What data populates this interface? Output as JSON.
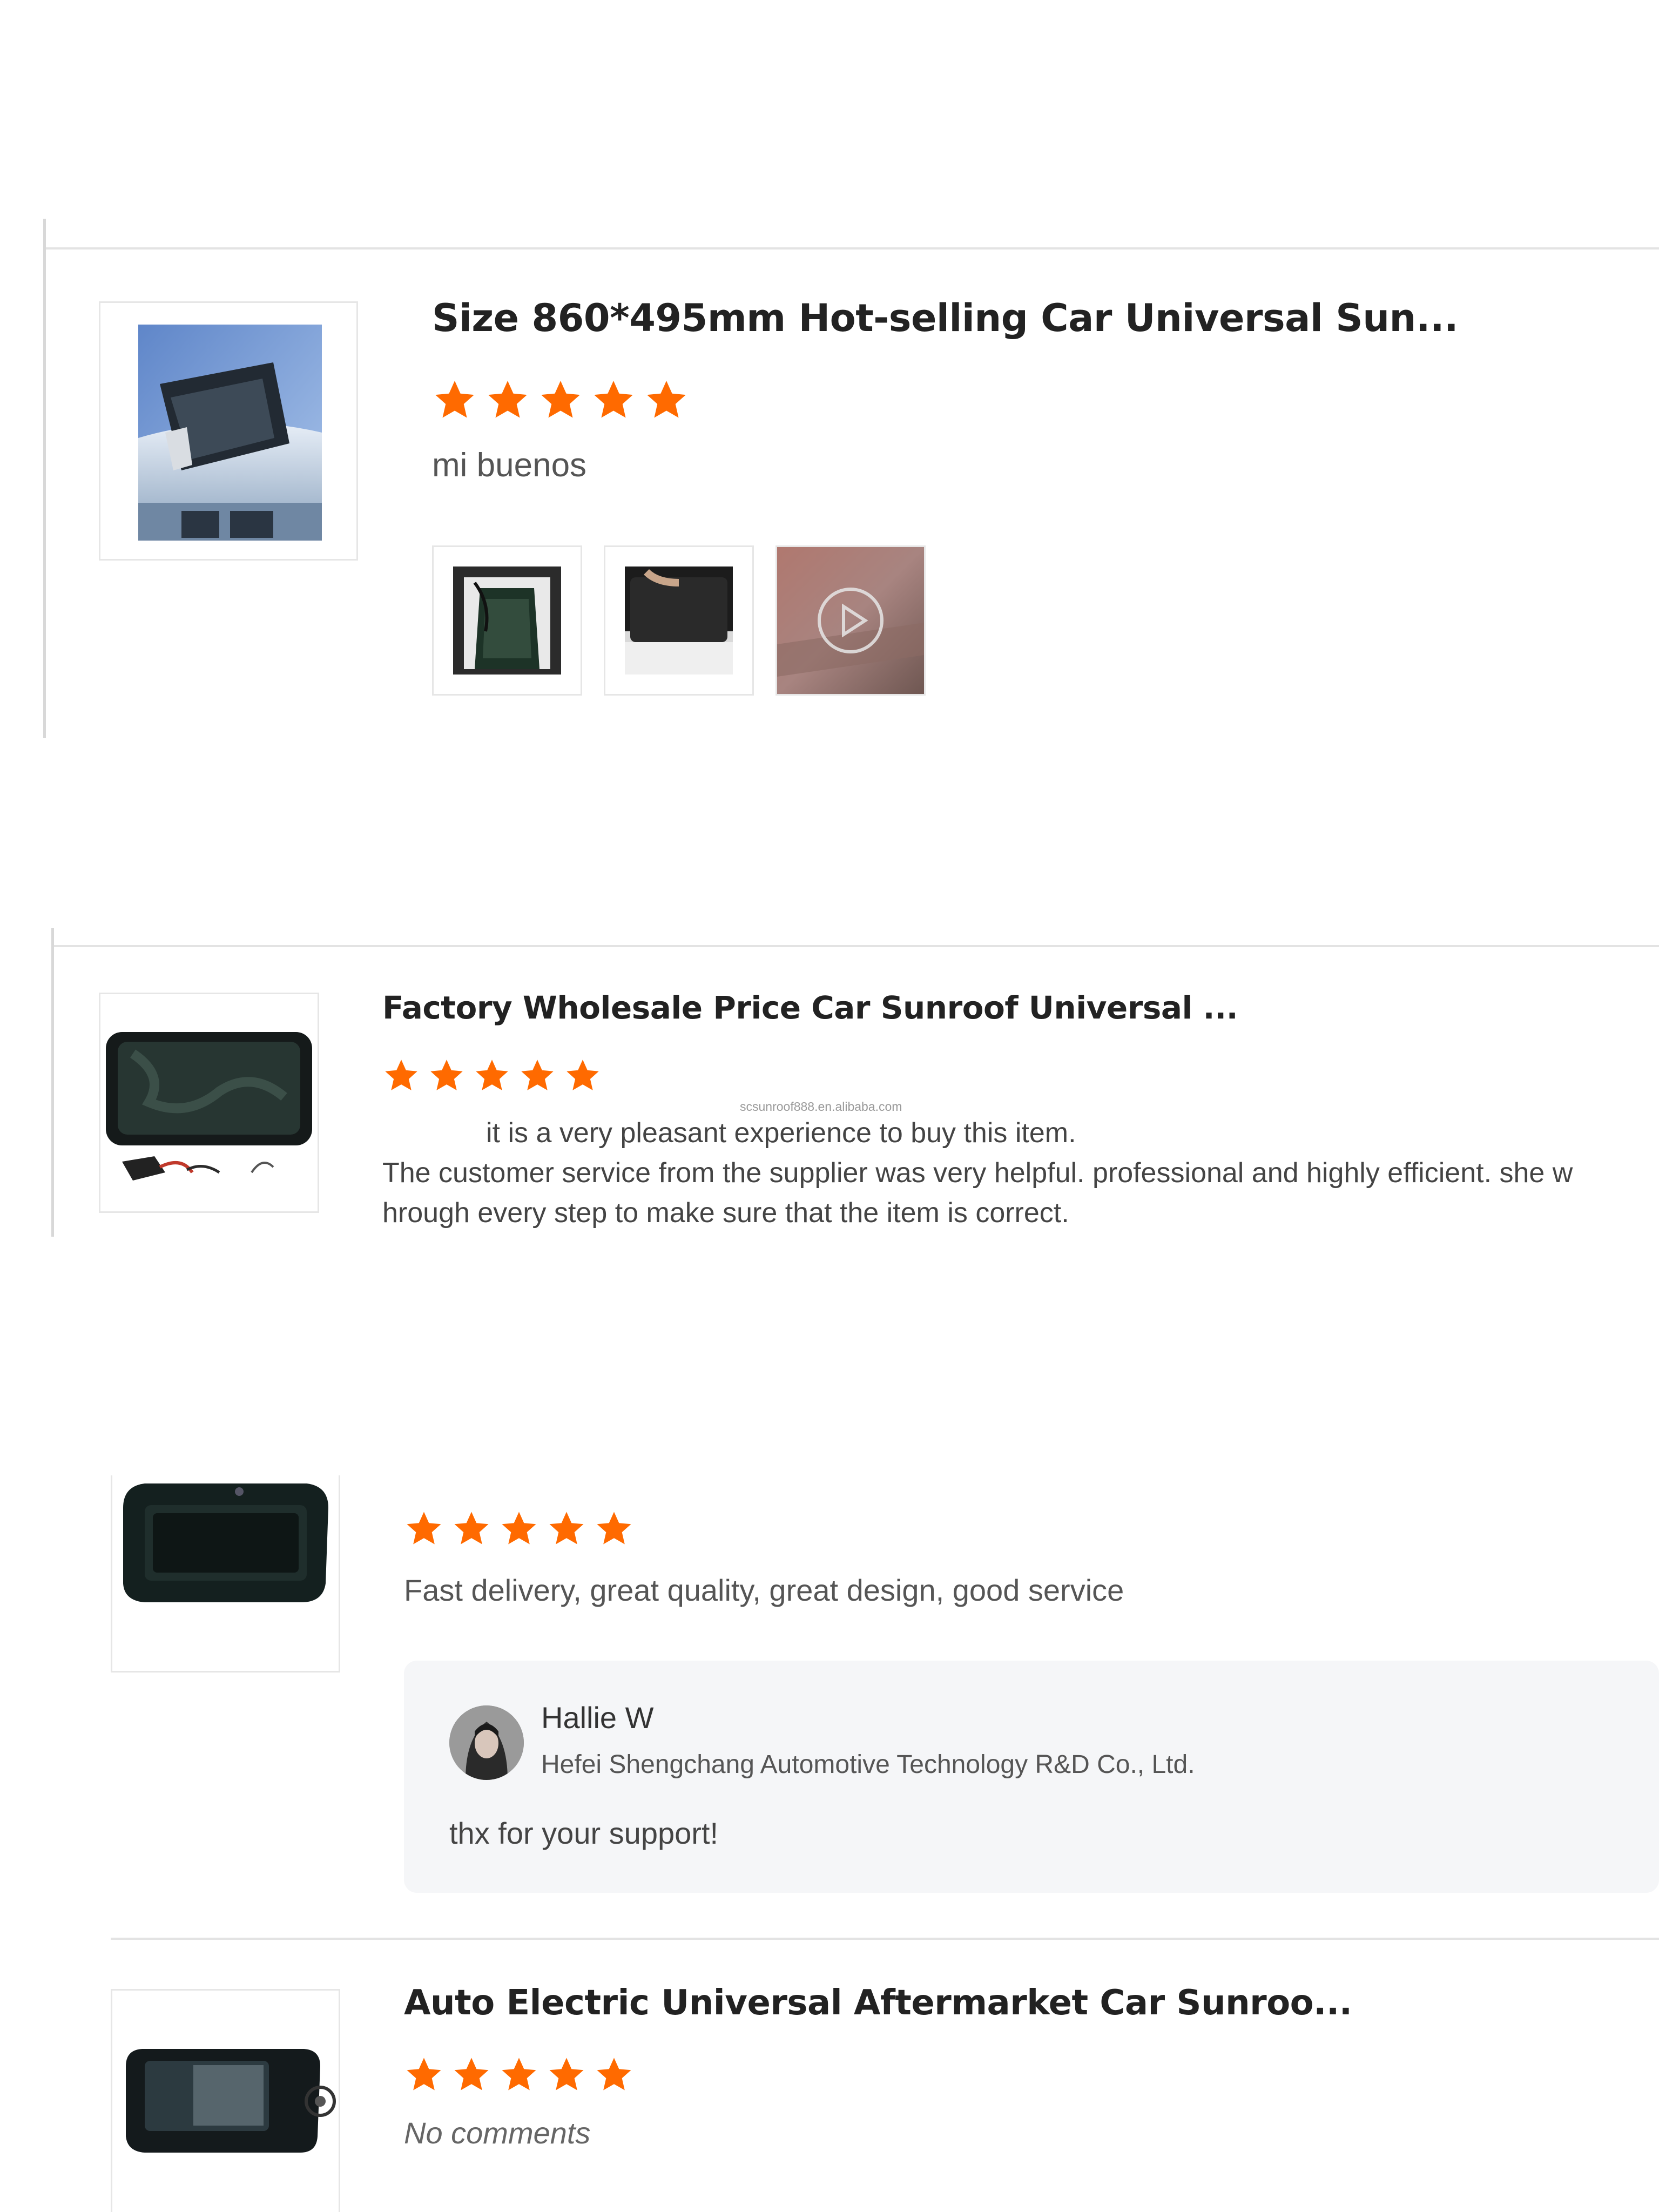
{
  "colors": {
    "star": "#ff6a00",
    "divider": "#e3e3e3",
    "reply_bg": "#f5f6f8"
  },
  "reviews": [
    {
      "title": "Size 860*495mm Hot-selling Car Universal Sun...",
      "rating": 5,
      "comment": "mi buenos",
      "media": [
        "photo",
        "photo",
        "video"
      ]
    },
    {
      "title": "Factory Wholesale Price Car Sunroof Universal ...",
      "rating": 5,
      "watermark": "scsunroof888.en.alibaba.com",
      "comment_lines": [
        "it is a very pleasant experience to buy this item.",
        "The customer service from the supplier was very helpful. professional and highly efficient. she w",
        "hrough every step to make sure that the item is correct."
      ]
    },
    {
      "rating": 5,
      "comment": "Fast delivery, great quality, great design, good service",
      "reply": {
        "name": "Hallie W",
        "company": "Hefei Shengchang Automotive Technology R&D Co., Ltd.",
        "text": "thx for your support!"
      }
    },
    {
      "title": "Auto Electric Universal Aftermarket Car Sunroo...",
      "rating": 5,
      "comment": "No comments"
    }
  ]
}
